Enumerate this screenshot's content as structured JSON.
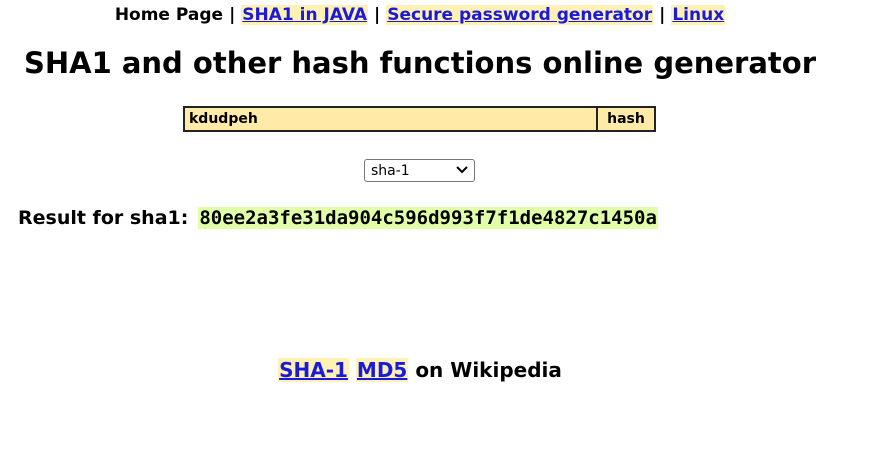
{
  "nav": {
    "home": "Home Page",
    "sep": "|",
    "links": [
      "SHA1 in JAVA",
      "Secure password generator",
      "Linux"
    ]
  },
  "title": "SHA1 and other hash functions online generator",
  "form": {
    "input_value": "kdudpeh",
    "button_label": "hash",
    "algorithm": "sha-1"
  },
  "result": {
    "label": "Result for sha1:",
    "value": "80ee2a3fe31da904c596d993f7f1de4827c1450a"
  },
  "wiki": {
    "links": [
      "SHA-1",
      "MD5"
    ],
    "suffix": "on Wikipedia"
  },
  "colors": {
    "link": "#1a1adb",
    "link_bg": "#fff0b3",
    "input_bg": "#ffeaa8",
    "result_bg": "#e0ffa8"
  }
}
